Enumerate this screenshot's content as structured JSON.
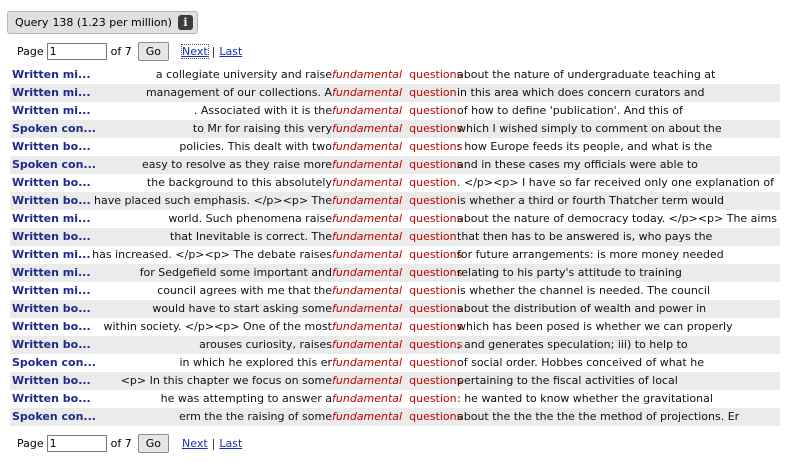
{
  "query": {
    "label": "Query",
    "count": "138 (1.23 per million)",
    "info_icon": "info-icon"
  },
  "pager": {
    "page_label": "Page",
    "page_value": "1",
    "of_label": "of 7",
    "go_label": "Go",
    "next_label": "Next",
    "separator": "|",
    "last_label": "Last"
  },
  "rows": [
    {
      "source": "Written mi...",
      "left": "a collegiate university and raise",
      "k1": "fundamental",
      "k2": "questions",
      "right": "about the nature of undergraduate teaching at"
    },
    {
      "source": "Written mi...",
      "left": "management of our collections. A",
      "k1": "fundamental",
      "k2": "question",
      "right": "in this area which does concern curators and"
    },
    {
      "source": "Written mi...",
      "left": ". Associated with it is the",
      "k1": "fundamental",
      "k2": "question",
      "right": "of how to define 'publication'. And this of"
    },
    {
      "source": "Spoken con...",
      "left": "to Mr for raising this very",
      "k1": "fundamental",
      "k2": "questions",
      "right": "which I wished simply to comment on about the"
    },
    {
      "source": "Written bo...",
      "left": "policies. This dealt with two",
      "k1": "fundamental",
      "k2": "questions",
      "right": ": how Europe feeds its people, and what is the"
    },
    {
      "source": "Spoken con...",
      "left": "easy to resolve as they raise more",
      "k1": "fundamental",
      "k2": "questions",
      "right": "and in these cases my officials were able to"
    },
    {
      "source": "Written bo...",
      "left": "the background to this absolutely",
      "k1": "fundamental",
      "k2": "question",
      "right": ". </p><p> I have so far received only one explanation of"
    },
    {
      "source": "Written bo...",
      "left": "have placed such emphasis. </p><p> The",
      "k1": "fundamental",
      "k2": "question",
      "right": "is whether a third or fourth Thatcher term would"
    },
    {
      "source": "Written mi...",
      "left": "world. Such phenomena raise",
      "k1": "fundamental",
      "k2": "questions",
      "right": "about the nature of democracy today. </p><p> The aims of"
    },
    {
      "source": "Written bo...",
      "left": "that Inevitable is correct. The",
      "k1": "fundamental",
      "k2": "question",
      "right": "that then has to be answered is, who pays the"
    },
    {
      "source": "Written mi...",
      "left": "has increased. </p><p> The debate raises",
      "k1": "fundamental",
      "k2": "questions",
      "right": "for future arrangements: is more money needed"
    },
    {
      "source": "Written mi...",
      "left": "for Sedgefield some important and",
      "k1": "fundamental",
      "k2": "questions",
      "right": "relating to his party's attitude to training"
    },
    {
      "source": "Written mi...",
      "left": "council agrees with me that the",
      "k1": "fundamental",
      "k2": "question",
      "right": "is whether the channel is needed. The council"
    },
    {
      "source": "Written bo...",
      "left": "would have to start asking some",
      "k1": "fundamental",
      "k2": "questions",
      "right": "about the distribution of wealth and power in"
    },
    {
      "source": "Written bo...",
      "left": "within society. </p><p> One of the most",
      "k1": "fundamental",
      "k2": "questions",
      "right": "which has been posed is whether we can properly"
    },
    {
      "source": "Written bo...",
      "left": "arouses curiosity, raises",
      "k1": "fundamental",
      "k2": "questions",
      "right": ", and generates speculation; iii) to help to"
    },
    {
      "source": "Spoken con...",
      "left": "in which he explored this er",
      "k1": "fundamental",
      "k2": "question",
      "right": "of social order. Hobbes conceived of what he"
    },
    {
      "source": "Written bo...",
      "left": "<p> In this chapter we focus on some",
      "k1": "fundamental",
      "k2": "questions",
      "right": "pertaining to the fiscal activities of local"
    },
    {
      "source": "Written bo...",
      "left": "he was attempting to answer a",
      "k1": "fundamental",
      "k2": "question",
      "right": ": he wanted to know whether the gravitational"
    },
    {
      "source": "Spoken con...",
      "left": "erm the the raising of some",
      "k1": "fundamental",
      "k2": "questions",
      "right": "about the the the the the method of projections. Er"
    }
  ]
}
